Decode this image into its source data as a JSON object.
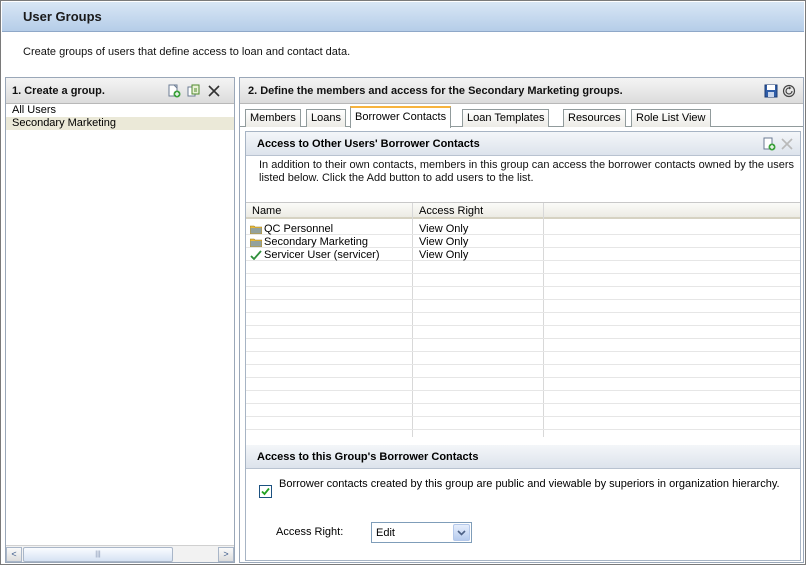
{
  "window": {
    "title": "User Groups"
  },
  "intro": {
    "text": "Create groups of users that define access to loan and contact data."
  },
  "left_panel": {
    "header": "1. Create a group.",
    "icons": [
      "add-group-icon",
      "copy-group-icon",
      "delete-group-icon"
    ],
    "groups": [
      {
        "label": "All Users",
        "selected": false
      },
      {
        "label": "Secondary Marketing",
        "selected": true
      }
    ],
    "scrollbar": {
      "left_arrow": "<",
      "right_arrow": ">",
      "thumb_grip": "|||"
    }
  },
  "right_panel": {
    "header": "2. Define the members and access for the Secondary Marketing groups.",
    "icons": [
      "save-icon",
      "reset-icon"
    ],
    "tabs": [
      {
        "label": "Members",
        "active": false
      },
      {
        "label": "Loans",
        "active": false
      },
      {
        "label": "Borrower Contacts",
        "active": true
      },
      {
        "label": "Loan Templates",
        "active": false
      },
      {
        "label": "Resources",
        "active": false
      },
      {
        "label": "Role List View",
        "active": false
      }
    ],
    "other_users_section": {
      "header": "Access to Other Users' Borrower Contacts",
      "description": "In addition to their own contacts, members in this group can access the borrower contacts owned by the users listed below. Click the Add button to add users to the list.",
      "columns": [
        "Name",
        "Access Right"
      ],
      "rows": [
        {
          "icon": "folder-icon",
          "name": "QC Personnel",
          "access": "View Only"
        },
        {
          "icon": "folder-icon",
          "name": "Secondary Marketing",
          "access": "View Only"
        },
        {
          "icon": "user-check-icon",
          "name": "Servicer User (servicer)",
          "access": "View Only"
        }
      ]
    },
    "group_section": {
      "header": "Access to this Group's Borrower Contacts",
      "checkbox_checked": true,
      "checkbox_label": "Borrower contacts created by this group are public and viewable by superiors in organization hierarchy.",
      "access_right_label": "Access Right:",
      "access_right_value": "Edit"
    }
  },
  "colors": {
    "title_bar": "#b5cde8",
    "selected_row": "#ebe9d8",
    "active_tab_accent": "#f7b33d"
  }
}
